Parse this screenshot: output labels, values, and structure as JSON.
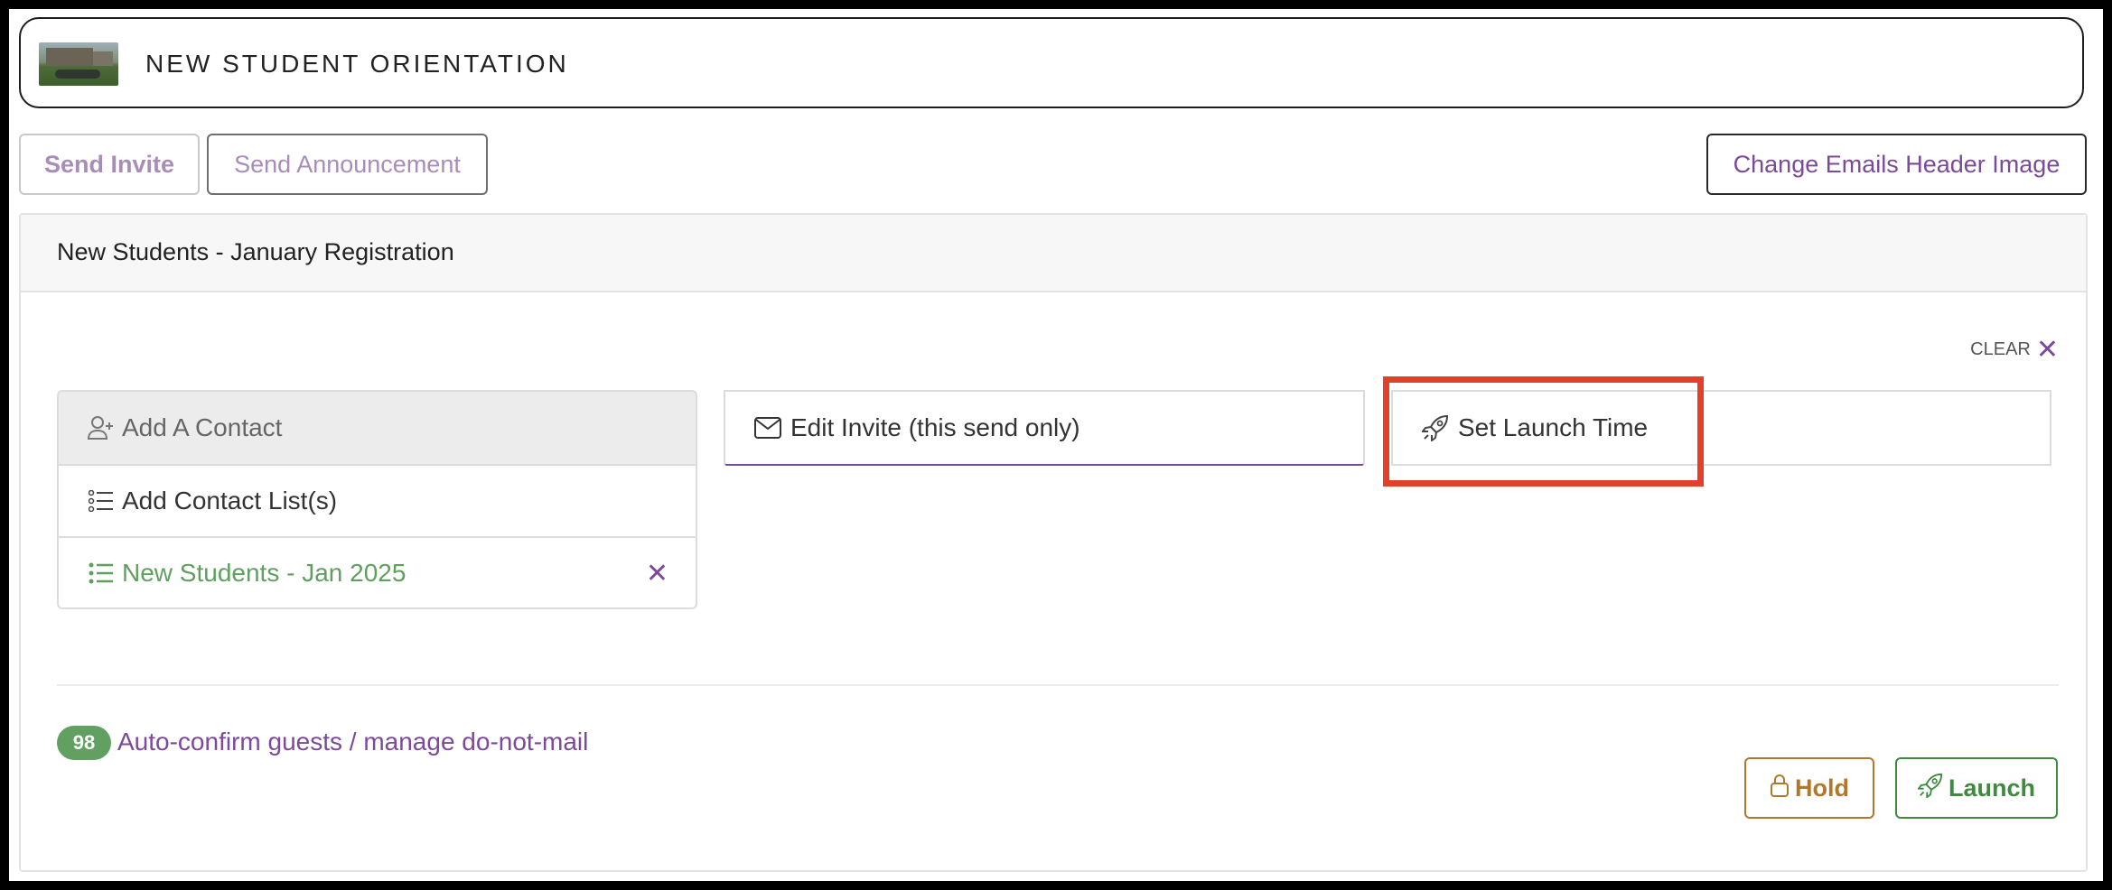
{
  "header": {
    "event_title": "NEW STUDENT ORIENTATION",
    "thumbnail_icon": "campus-photo"
  },
  "toolbar": {
    "send_invite_label": "Send Invite",
    "send_announcement_label": "Send Announcement",
    "change_header_label": "Change Emails Header Image"
  },
  "panel": {
    "title": "New Students - January Registration",
    "clear_label": "CLEAR",
    "contacts": {
      "add_contact_label": "Add A Contact",
      "add_list_label": "Add Contact List(s)",
      "selected_list": "New Students - Jan 2025"
    },
    "tabs": {
      "edit_invite_label": "Edit Invite (this send only)",
      "launch_time_label": "Set Launch Time"
    },
    "footer": {
      "count_badge": "98",
      "auto_confirm_link": "Auto-confirm guests / manage do-not-mail",
      "hold_label": "Hold",
      "launch_label": "Launch"
    }
  },
  "colors": {
    "accent": "#7b4a9a",
    "success": "#62a062",
    "warning": "#b0782a",
    "highlight": "#e2402b"
  }
}
